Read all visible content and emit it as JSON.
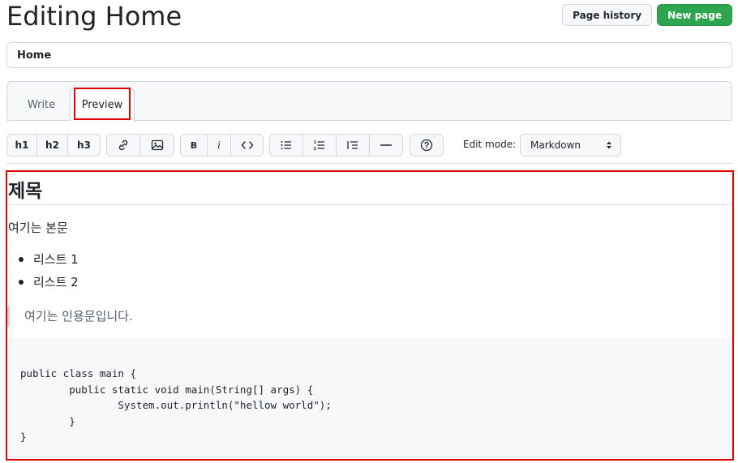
{
  "header": {
    "title": "Editing Home",
    "page_history_label": "Page history",
    "new_page_label": "New page"
  },
  "title_field": {
    "value": "Home"
  },
  "tabs": [
    {
      "label": "Write",
      "active": false
    },
    {
      "label": "Preview",
      "active": true
    }
  ],
  "toolbar": {
    "heading_buttons": [
      "h1",
      "h2",
      "h3"
    ],
    "bold_label": "B",
    "italic_label": "i",
    "icons": [
      "link-icon",
      "image-icon",
      "code-icon",
      "unordered-list-icon",
      "ordered-list-icon",
      "quote-icon",
      "horizontal-rule-icon",
      "help-icon"
    ],
    "edit_mode_label": "Edit mode:",
    "edit_mode_value": "Markdown"
  },
  "preview": {
    "heading": "제목",
    "paragraph": "여기는 본문",
    "list": [
      "리스트 1",
      "리스트 2"
    ],
    "quote": "여기는 인용문입니다.",
    "code": "public class main {\n        public static void main(String[] args) {\n                System.out.println(\"hellow world\");\n        }\n}"
  },
  "colors": {
    "primary_button": "#2da44e",
    "highlight_box": "#e00000"
  }
}
